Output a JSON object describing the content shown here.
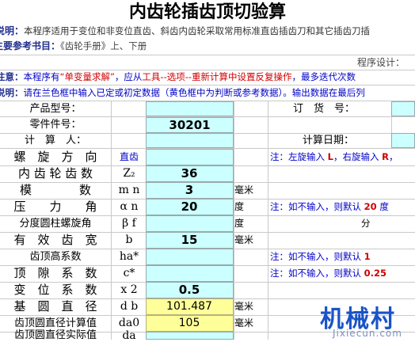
{
  "title": "内齿轮插齿顶切验算",
  "desc": {
    "label": "说明：",
    "text": "本程序适用于变位和非变位直齿、斜齿内齿轮采取常用标准直齿插齿刀和其它插齿刀插"
  },
  "ref": {
    "label": "主要参考书目：",
    "text": "《齿轮手册》上、下册"
  },
  "designer": "程序设计：",
  "warn": {
    "label": "注意：",
    "t1": "本程序有",
    "t2": "“单变量求解”",
    "t3": "，应从",
    "t4": "工具--选项--重新计算中设置反复操作",
    "t5": "，最多迭代次数"
  },
  "note2": {
    "label": "说明：",
    "t1": "请在兰色框中输入已定或初定数据（",
    "t2": "黄色框中为判断或参考数据",
    "t3": "）。输出数据在最后列"
  },
  "header": {
    "product_model": "产品型号：",
    "order_no": "订　货　号：",
    "part_no_label": "零件件号：",
    "part_no_value": "30201",
    "calculator": "计　算　人：",
    "calc_date": "计算日期："
  },
  "rows": [
    {
      "label": "螺　旋　方　向",
      "sym": "直齿",
      "value": "",
      "unit": "",
      "note": "注：左旋输入 L，右旋输入 R，"
    },
    {
      "label": "内 齿 轮 齿 数",
      "sym": "Z₂",
      "value": "36",
      "unit": "",
      "note": ""
    },
    {
      "label": "模　　　　数",
      "sym": "m n",
      "value": "3",
      "unit": "毫米",
      "note": ""
    },
    {
      "label": "压　　力　　角",
      "sym": "α n",
      "value": "20",
      "unit": "度",
      "note": "注：如不输入，则默认 20  度"
    },
    {
      "label": "分度圆柱螺旋角",
      "sym": "β f",
      "value": "",
      "unit": "度",
      "note": "分"
    },
    {
      "label": "有　效　齿　宽",
      "sym": "b",
      "value": "15",
      "unit": "毫米",
      "note": ""
    },
    {
      "label": "齿顶高系数",
      "sym": "ha*",
      "value": "",
      "unit": "",
      "note": "注：如不输入，则默认 1"
    },
    {
      "label": "顶　隙　系　数",
      "sym": "c*",
      "value": "",
      "unit": "",
      "note": "注：如不输入，则默认 0.25"
    },
    {
      "label": "变　位　系　数",
      "sym": "x 2",
      "value": "0.5",
      "unit": "",
      "note": ""
    },
    {
      "label": "基　圆　直　径",
      "sym": "d b",
      "value": "101.487",
      "unit": "毫米",
      "note": ""
    },
    {
      "label": "齿顶圆直径计算值",
      "sym": "da0",
      "value": "105",
      "unit": "毫米",
      "note": ""
    },
    {
      "label": "齿顶圆直径实际值",
      "sym": "da",
      "value": "",
      "unit": "",
      "note": ""
    }
  ],
  "watermark": {
    "main": "机械村",
    "sub": "Jixiecun.com"
  },
  "colors": {
    "input": "#ccffff",
    "reference": "#ffff99",
    "label_blue": "#1f2f8f",
    "red": "#d00000"
  }
}
